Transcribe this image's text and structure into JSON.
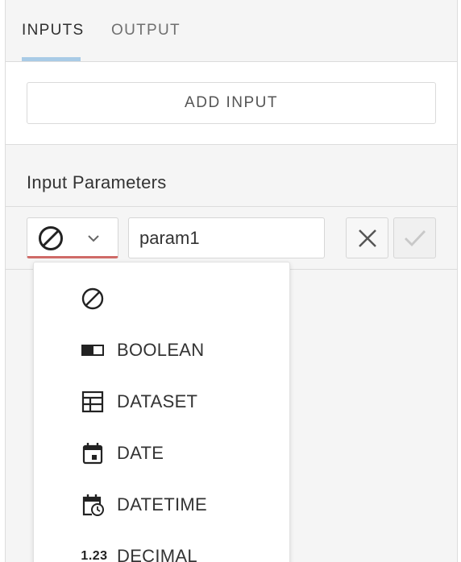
{
  "tabs": [
    {
      "label": "INPUTS",
      "active": true
    },
    {
      "label": "OUTPUT",
      "active": false
    }
  ],
  "add_input": {
    "label": "ADD INPUT"
  },
  "section_title": "Input Parameters",
  "param_row": {
    "type_icon": "none-type-icon",
    "name_value": "param1",
    "accent_color": "#cf6a67"
  },
  "dropdown": {
    "items": [
      {
        "icon": "none-type-icon",
        "label": ""
      },
      {
        "icon": "boolean-toggle-icon",
        "label": "BOOLEAN"
      },
      {
        "icon": "dataset-table-icon",
        "label": "DATASET"
      },
      {
        "icon": "calendar-icon",
        "label": "DATE"
      },
      {
        "icon": "calendar-clock-icon",
        "label": "DATETIME"
      },
      {
        "icon": "decimal-icon",
        "icon_text": "1.23",
        "label": "DECIMAL"
      }
    ]
  },
  "colors": {
    "tab_indicator": "#a9cbe6",
    "panel_bg": "#f5f5f5"
  }
}
